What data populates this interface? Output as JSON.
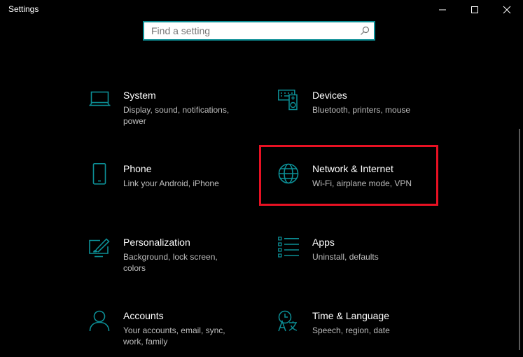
{
  "window": {
    "title": "Settings"
  },
  "search": {
    "placeholder": "Find a setting",
    "value": ""
  },
  "colors": {
    "accent": "#0c8f96",
    "highlight": "#e81123",
    "background": "#000000",
    "secondary_text": "#bdbdbd"
  },
  "tiles": [
    {
      "name": "System",
      "desc": "Display, sound, notifications, power",
      "icon": "laptop-icon"
    },
    {
      "name": "Devices",
      "desc": "Bluetooth, printers, mouse",
      "icon": "keyboard-speaker-icon"
    },
    {
      "name": "Phone",
      "desc": "Link your Android, iPhone",
      "icon": "phone-icon"
    },
    {
      "name": "Network & Internet",
      "desc": "Wi-Fi, airplane mode, VPN",
      "icon": "globe-icon"
    },
    {
      "name": "Personalization",
      "desc": "Background, lock screen, colors",
      "icon": "paintbrush-icon"
    },
    {
      "name": "Apps",
      "desc": "Uninstall, defaults",
      "icon": "list-icon"
    },
    {
      "name": "Accounts",
      "desc": "Your accounts, email, sync, work, family",
      "icon": "person-icon"
    },
    {
      "name": "Time & Language",
      "desc": "Speech, region, date",
      "icon": "time-language-icon"
    }
  ]
}
